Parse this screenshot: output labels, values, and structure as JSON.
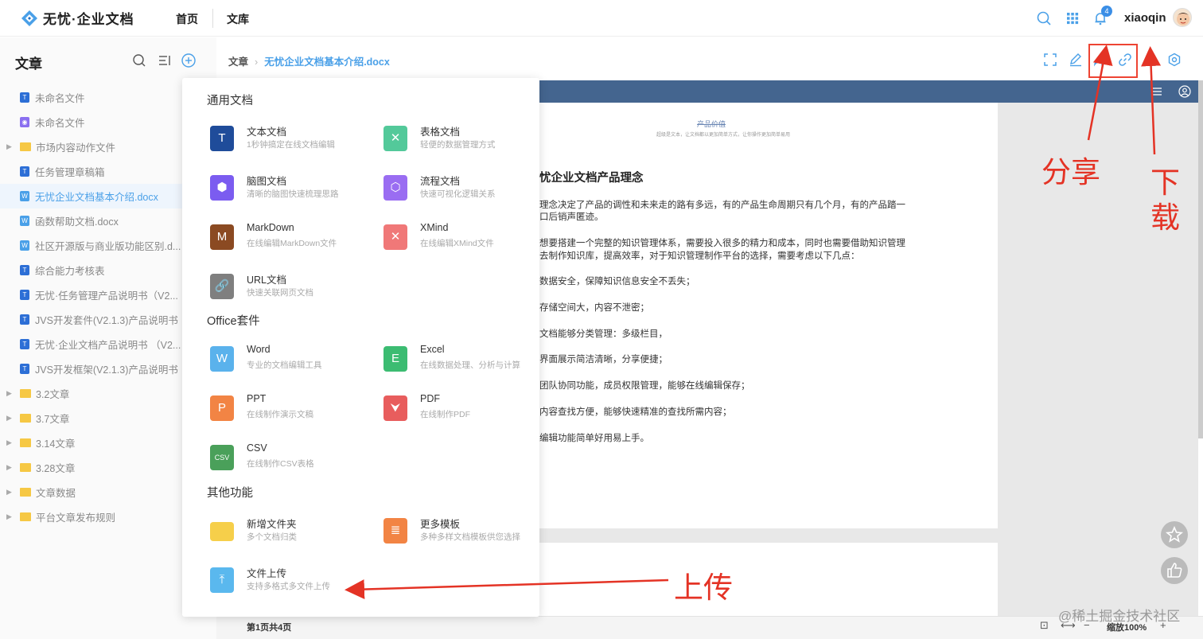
{
  "header": {
    "app_name": "无忧·企业文档",
    "nav": [
      "首页",
      "文库"
    ],
    "notification_count": "4",
    "username": "xiaoqin"
  },
  "sidebar": {
    "title": "文章",
    "items": [
      {
        "label": "未命名文件",
        "kind": "doc",
        "color": "#2d6fd6"
      },
      {
        "label": "未命名文件",
        "kind": "mind",
        "color": "#8a6ff0"
      },
      {
        "label": "市场内容动作文件",
        "kind": "folder"
      },
      {
        "label": "任务管理章稿箱",
        "kind": "doc",
        "color": "#2d6fd6"
      },
      {
        "label": "无忧企业文档基本介绍.docx",
        "kind": "word",
        "color": "#4aa0e8",
        "active": true
      },
      {
        "label": "函数帮助文档.docx",
        "kind": "word",
        "color": "#4aa0e8"
      },
      {
        "label": "社区开源版与商业版功能区别.d...",
        "kind": "word",
        "color": "#4aa0e8"
      },
      {
        "label": "综合能力考核表",
        "kind": "doc",
        "color": "#2d6fd6"
      },
      {
        "label": "无忧·任务管理产品说明书（V2...",
        "kind": "doc",
        "color": "#2d6fd6"
      },
      {
        "label": "JVS开发套件(V2.1.3)产品说明书",
        "kind": "doc",
        "color": "#2d6fd6"
      },
      {
        "label": "无忧·企业文档产品说明书 （V2...",
        "kind": "doc",
        "color": "#2d6fd6"
      },
      {
        "label": "JVS开发框架(V2.1.3)产品说明书",
        "kind": "doc",
        "color": "#2d6fd6"
      },
      {
        "label": "3.2文章",
        "kind": "folder"
      },
      {
        "label": "3.7文章",
        "kind": "folder"
      },
      {
        "label": "3.14文章",
        "kind": "folder"
      },
      {
        "label": "3.28文章",
        "kind": "folder"
      },
      {
        "label": "文章数据",
        "kind": "folder"
      },
      {
        "label": "平台文章发布规则",
        "kind": "folder"
      }
    ]
  },
  "breadcrumb": {
    "root": "文章",
    "current": "无忧企业文档基本介绍.docx"
  },
  "document": {
    "page_heading": "产品价值",
    "page_subheading": "超级是文本，让文档都以更加简单方式，让你操作更加简单易用",
    "title": "忧企业文档产品理念",
    "lines": [
      "理念决定了产品的调性和未来走的路有多远，有的产品生命周期只有几个月，有的产品踏一",
      "口后销声匿迹。",
      "想要搭建一个完整的知识管理体系，需要投入很多的精力和成本，同时也需要借助知识管理",
      "去制作知识库，提高效率，对于知识管理制作平台的选择，需要考虑以下几点：",
      "数据安全，保障知识信息安全不丢失；",
      "存储空间大，内容不泄密；",
      "文档能够分类管理：多级栏目，",
      "界面展示简洁清晰，分享便捷；",
      "团队协同功能，成员权限管理，能够在线编辑保存；",
      "内容查找方便，能够快速精准的查找所需内容；",
      "编辑功能简单好用易上手。"
    ]
  },
  "status": {
    "page_info": "第1页共4页",
    "zoom": "缩放100%",
    "corner_text": "@稀土掘金技术社区"
  },
  "menu": {
    "sections": [
      {
        "title": "通用文档",
        "items": [
          {
            "title": "文本文档",
            "desc": "1秒钟搞定在线文档编辑",
            "icon": "text-doc-icon",
            "color": "#1f4c9a",
            "glyph": "T"
          },
          {
            "title": "表格文档",
            "desc": "轻便的数据管理方式",
            "icon": "table-doc-icon",
            "color": "#53c99a",
            "glyph": "✕"
          },
          {
            "title": "脑图文档",
            "desc": "清晰的脑图快速梳理思路",
            "icon": "mind-doc-icon",
            "color": "#7b5cf0",
            "glyph": "⬢"
          },
          {
            "title": "流程文档",
            "desc": "快速可视化逻辑关系",
            "icon": "flow-doc-icon",
            "color": "#9a6df2",
            "glyph": "⬡"
          },
          {
            "title": "MarkDown",
            "desc": "在线编辑MarkDown文件",
            "icon": "markdown-icon",
            "color": "#8b4a22",
            "glyph": "M"
          },
          {
            "title": "XMind",
            "desc": "在线编辑XMind文件",
            "icon": "xmind-icon",
            "color": "#f07878",
            "glyph": "✕"
          },
          {
            "title": "URL文档",
            "desc": "快速关联网页文档",
            "icon": "url-doc-icon",
            "color": "#7f7f7f",
            "glyph": "🔗"
          }
        ]
      },
      {
        "title": "Office套件",
        "items": [
          {
            "title": "Word",
            "desc": "专业的文档编辑工具",
            "icon": "word-icon",
            "color": "#5ab2ec",
            "glyph": "W"
          },
          {
            "title": "Excel",
            "desc": "在线数据处理、分析与计算",
            "icon": "excel-icon",
            "color": "#3cbc72",
            "glyph": "E"
          },
          {
            "title": "PPT",
            "desc": "在线制作演示文稿",
            "icon": "ppt-icon",
            "color": "#f28444",
            "glyph": "P"
          },
          {
            "title": "PDF",
            "desc": "在线制作PDF",
            "icon": "pdf-icon",
            "color": "#e85d5d",
            "glyph": "⮟"
          },
          {
            "title": "CSV",
            "desc": "在线制作CSV表格",
            "icon": "csv-icon",
            "color": "#4aa05a",
            "glyph": "CSV"
          }
        ]
      },
      {
        "title": "其他功能",
        "items": [
          {
            "title": "新增文件夹",
            "desc": "多个文档归类",
            "icon": "folder-icon",
            "color": "#f6cf4a",
            "glyph": ""
          },
          {
            "title": "更多模板",
            "desc": "多种多样文档模板供您选择",
            "icon": "template-icon",
            "color": "#f28444",
            "glyph": "≣"
          },
          {
            "title": "文件上传",
            "desc": "支持多格式多文件上传",
            "icon": "upload-icon",
            "color": "#5ab8ee",
            "glyph": "⤒"
          }
        ]
      }
    ]
  },
  "annotations": {
    "share": "分享",
    "download": "下载",
    "upload": "上传"
  },
  "colors": {
    "accent": "#4aa0e8",
    "annotation": "#e43325",
    "doc_header": "#44658f"
  }
}
